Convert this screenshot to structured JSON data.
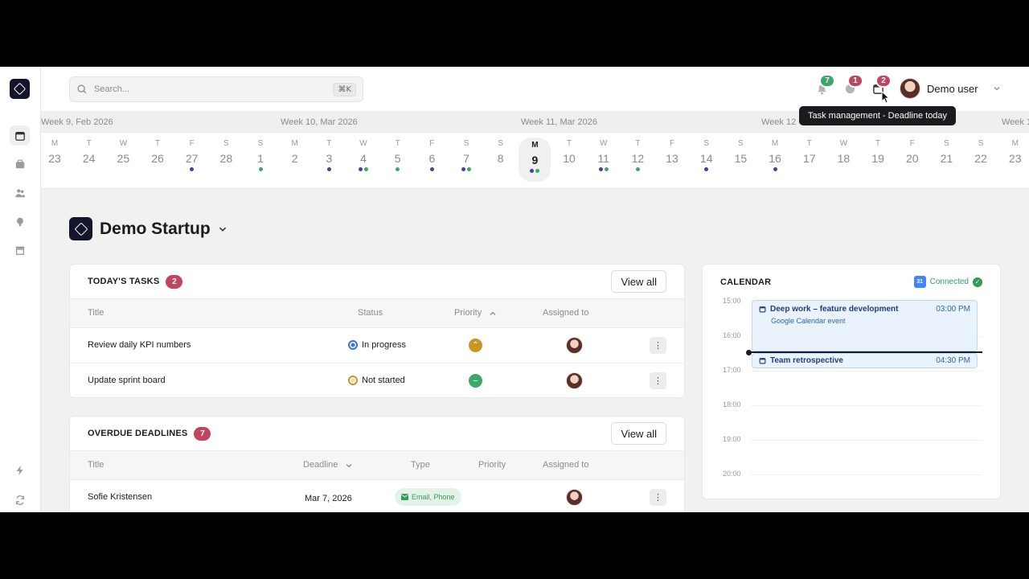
{
  "colors": {
    "brand": "#14142b",
    "green": "#3aa86b",
    "red": "#c0455e",
    "purple": "#4b3f8f",
    "blue": "#3a73d9",
    "gold": "#c99623"
  },
  "search": {
    "placeholder": "Search...",
    "shortcut": "⌘K"
  },
  "notifications": [
    {
      "icon": "bell-icon",
      "count": "7",
      "color": "#3aa86b"
    },
    {
      "icon": "chat-icon",
      "count": "1",
      "color": "#c0455e"
    },
    {
      "icon": "calendar-task-icon",
      "count": "2",
      "color": "#c0455e"
    }
  ],
  "user": {
    "name": "Demo user"
  },
  "tooltip": "Task management - Deadline today",
  "sidebar": {
    "icons": [
      "calendar-icon",
      "briefcase-icon",
      "users-icon",
      "lightbulb-icon",
      "store-icon",
      "bolt-icon",
      "sync-icon"
    ]
  },
  "weeks": [
    "Week 9, Feb 2026",
    "Week 10, Mar 2026",
    "Week 11, Mar 2026",
    "Week 12",
    "Week 1"
  ],
  "days": [
    {
      "dow": "M",
      "num": "23",
      "dots": []
    },
    {
      "dow": "T",
      "num": "24",
      "dots": []
    },
    {
      "dow": "W",
      "num": "25",
      "dots": []
    },
    {
      "dow": "T",
      "num": "26",
      "dots": []
    },
    {
      "dow": "F",
      "num": "27",
      "dots": [
        "purple"
      ]
    },
    {
      "dow": "S",
      "num": "28",
      "dots": []
    },
    {
      "dow": "S",
      "num": "1",
      "dots": [
        "green"
      ]
    },
    {
      "dow": "M",
      "num": "2",
      "dots": []
    },
    {
      "dow": "T",
      "num": "3",
      "dots": [
        "purple"
      ]
    },
    {
      "dow": "W",
      "num": "4",
      "dots": [
        "purple",
        "green"
      ]
    },
    {
      "dow": "T",
      "num": "5",
      "dots": [
        "green"
      ]
    },
    {
      "dow": "F",
      "num": "6",
      "dots": [
        "purple"
      ]
    },
    {
      "dow": "S",
      "num": "7",
      "dots": [
        "purple",
        "green"
      ]
    },
    {
      "dow": "S",
      "num": "8",
      "dots": []
    },
    {
      "dow": "M",
      "num": "9",
      "dots": [
        "purple",
        "green"
      ],
      "today": true
    },
    {
      "dow": "T",
      "num": "10",
      "dots": []
    },
    {
      "dow": "W",
      "num": "11",
      "dots": [
        "purple",
        "green"
      ]
    },
    {
      "dow": "T",
      "num": "12",
      "dots": [
        "green"
      ]
    },
    {
      "dow": "F",
      "num": "13",
      "dots": []
    },
    {
      "dow": "S",
      "num": "14",
      "dots": [
        "purple"
      ]
    },
    {
      "dow": "S",
      "num": "15",
      "dots": []
    },
    {
      "dow": "M",
      "num": "16",
      "dots": [
        "purple"
      ]
    },
    {
      "dow": "T",
      "num": "17",
      "dots": []
    },
    {
      "dow": "W",
      "num": "18",
      "dots": []
    },
    {
      "dow": "T",
      "num": "19",
      "dots": []
    },
    {
      "dow": "F",
      "num": "20",
      "dots": []
    },
    {
      "dow": "S",
      "num": "21",
      "dots": []
    },
    {
      "dow": "S",
      "num": "22",
      "dots": []
    },
    {
      "dow": "M",
      "num": "23",
      "dots": []
    }
  ],
  "workspace": {
    "name": "Demo Startup"
  },
  "tasks": {
    "title": "TODAY'S TASKS",
    "count": "2",
    "view_all": "View all",
    "columns": {
      "title": "Title",
      "status": "Status",
      "priority": "Priority",
      "assigned": "Assigned to"
    },
    "rows": [
      {
        "title": "Review daily KPI numbers",
        "status": "In progress",
        "status_color": "#3a73d9",
        "priority": "high",
        "priority_color": "#c99623",
        "priority_glyph": "⌃"
      },
      {
        "title": "Update sprint board",
        "status": "Not started",
        "status_color": "#c99623",
        "priority": "medium",
        "priority_color": "#3aa86b",
        "priority_glyph": "–"
      }
    ]
  },
  "deadlines": {
    "title": "OVERDUE DEADLINES",
    "count": "7",
    "view_all": "View all",
    "columns": {
      "title": "Title",
      "deadline": "Deadline",
      "type": "Type",
      "priority": "Priority",
      "assigned": "Assigned to"
    },
    "rows": [
      {
        "title": "Sofie Kristensen",
        "deadline": "Mar 7, 2026",
        "type": "Email, Phone"
      }
    ]
  },
  "calendar": {
    "title": "CALENDAR",
    "status": "Connected",
    "gcal_badge": "31",
    "hours": [
      "15:00",
      "16:00",
      "17:00",
      "18:00",
      "19:00",
      "20:00"
    ],
    "events": [
      {
        "title": "Deep work – feature development",
        "time": "03:00 PM",
        "sub": "Google Calendar event"
      },
      {
        "title": "Team retrospective",
        "time": "04:30 PM"
      }
    ]
  }
}
